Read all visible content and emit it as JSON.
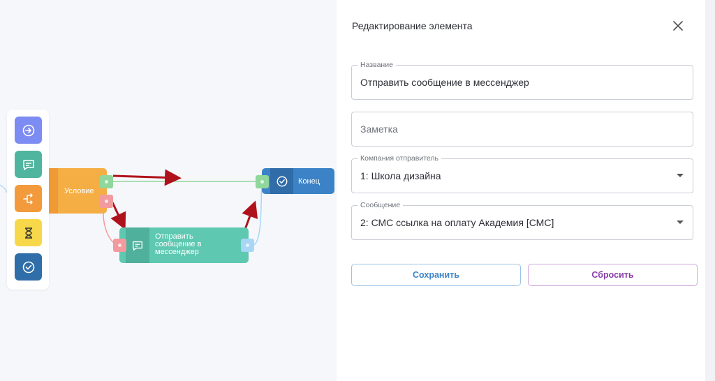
{
  "canvas": {
    "toolbar": [
      {
        "name": "start-tool",
        "icon": "arrow-circle-right-icon",
        "color": "#7d8cf2"
      },
      {
        "name": "message-tool",
        "icon": "message-icon",
        "color": "#4fb59e"
      },
      {
        "name": "condition-tool",
        "icon": "branch-icon",
        "color": "#f29a3c"
      },
      {
        "name": "delay-tool",
        "icon": "hourglass-icon",
        "color": "#f7d84a"
      },
      {
        "name": "end-tool",
        "icon": "check-circle-icon",
        "color": "#2f6ea8"
      }
    ],
    "nodes": {
      "condition": {
        "label": "Условие",
        "color": "#f5ae44"
      },
      "message": {
        "label": "Отправить сообщение в мессенджер",
        "color": "#5ec8b1"
      },
      "end": {
        "label": "Конец",
        "color": "#3b83c6"
      }
    },
    "colors": {
      "arrow": "#b0121b",
      "success_wire": "#8fd79b",
      "fail_wire": "#f29a9e",
      "end_wire": "#a7d6f6"
    }
  },
  "panel": {
    "title": "Редактирование элемента",
    "fields": {
      "name": {
        "label": "Название",
        "value": "Отправить сообщение в мессенджер"
      },
      "note": {
        "placeholder": "Заметка",
        "value": ""
      },
      "company": {
        "label": "Компания отправитель",
        "value": "1: Школа дизайна"
      },
      "message": {
        "label": "Сообщение",
        "value": "2: СМС ссылка на оплату Академия [СМС]"
      }
    },
    "buttons": {
      "save": "Сохранить",
      "reset": "Сбросить"
    },
    "colors": {
      "save": "#3a84c7",
      "reset": "#8a3da9"
    }
  }
}
